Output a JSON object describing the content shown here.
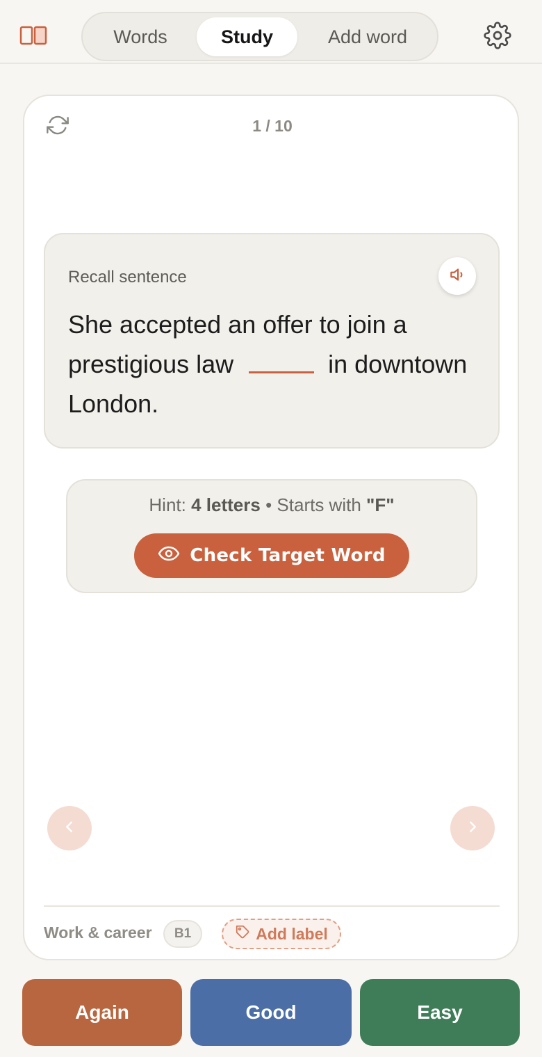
{
  "header": {
    "tabs": [
      {
        "label": "Words",
        "active": false
      },
      {
        "label": "Study",
        "active": true
      },
      {
        "label": "Add word",
        "active": false
      }
    ],
    "logo_icon": "book-open-icon",
    "settings_icon": "gear-icon"
  },
  "card": {
    "progress": "1 / 10",
    "refresh_icon": "refresh-icon",
    "sentence": {
      "label": "Recall sentence",
      "before_blank": "She accepted an offer to join a prestigious law",
      "after_blank": "in downtown London.",
      "speaker_icon": "speaker-icon"
    },
    "hint": {
      "prefix": "Hint:",
      "letters": "4 letters",
      "separator": "•",
      "starts_prefix": "Starts with",
      "starts_letter": "\"F\""
    },
    "check_button": "Check Target Word",
    "footer": {
      "topic": "Work & career",
      "level": "B1",
      "add_label": "Add label"
    }
  },
  "grading": {
    "again": "Again",
    "good": "Good",
    "easy": "Easy"
  },
  "colors": {
    "accent": "#c9613e",
    "again": "#b86640",
    "good": "#4a6ea5",
    "easy": "#3f7d59",
    "background": "#f8f6f2"
  }
}
